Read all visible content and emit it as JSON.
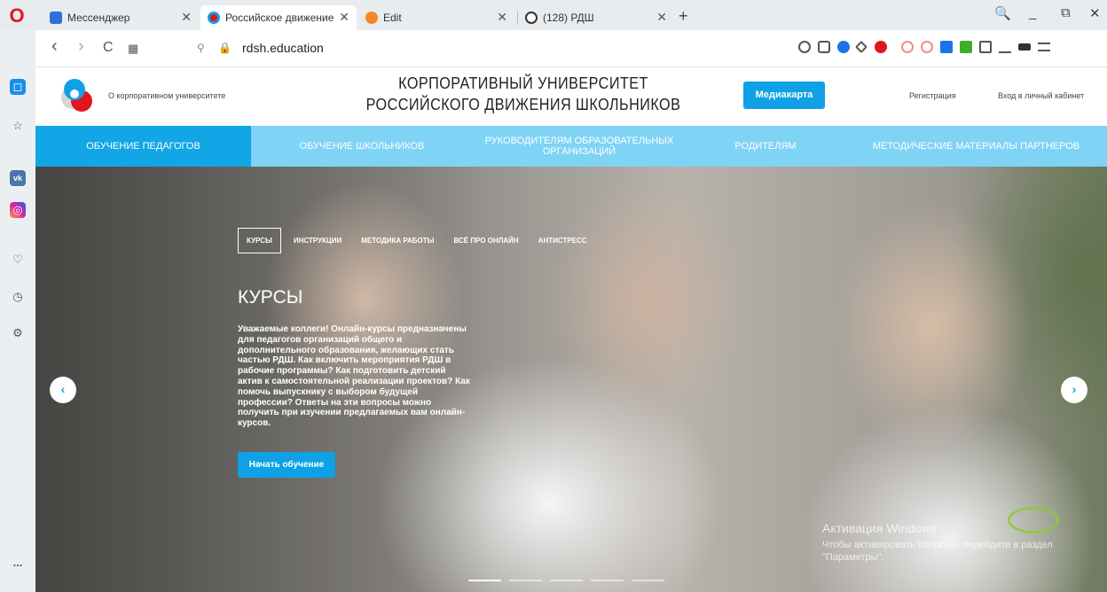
{
  "browser": {
    "tabs": [
      {
        "title": "Мессенджер",
        "active": false
      },
      {
        "title": "Российское движение шк",
        "active": true
      },
      {
        "title": "Edit",
        "active": false
      },
      {
        "title": "(128) РДШ",
        "active": false
      }
    ],
    "new_tab": "+",
    "close_glyph": "✕",
    "url": "rdsh.education",
    "controls": {
      "search": "🔍",
      "minimize": "_",
      "maximize": "⧉",
      "close": "✕"
    },
    "nav": {
      "back": "‹",
      "forward": "›",
      "reload": "C",
      "grid": "▦"
    }
  },
  "sidebar": {
    "icons": [
      "opera-home-icon",
      "bookmarks-star-icon",
      "vk-icon",
      "instagram-icon",
      "heart-icon",
      "history-clock-icon",
      "settings-gear-icon",
      "more-dots-icon"
    ],
    "more_label": "..."
  },
  "header": {
    "about_link": "О корпоративном университете",
    "title": "Корпоративный университет Российского движения школьников",
    "mediamap_button": "Медиакарта",
    "register_link": "Регистрация",
    "login_link": "Вход в личный кабинет"
  },
  "nav": {
    "items": [
      {
        "label": "Обучение педагогов",
        "active": true
      },
      {
        "label": "Обучение школьников",
        "active": false
      },
      {
        "label": "Руководителям образовательных организаций",
        "active": false
      },
      {
        "label": "Родителям",
        "active": false
      },
      {
        "label": "Методические материалы партнеров",
        "active": false
      }
    ]
  },
  "hero": {
    "tabs": [
      {
        "label": "Курсы",
        "active": true
      },
      {
        "label": "Инструкции",
        "active": false
      },
      {
        "label": "Методика работы",
        "active": false
      },
      {
        "label": "Всё про онлайн",
        "active": false
      },
      {
        "label": "Антистресс",
        "active": false
      }
    ],
    "heading": "Курсы",
    "text": "Уважаемые коллеги! Онлайн-курсы предназначены для педагогов организаций общего и дополнительного образования, желающих стать частью РДШ. Как включить мероприятия РДШ в рабочие программы? Как подготовить детский актив к самостоятельной реализации проектов? Как помочь выпускнику с выбором будущей профессии? Ответы на эти вопросы можно получить при изучении предлагаемых вам онлайн-курсов.",
    "cta": "Начать обучение",
    "prev": "‹",
    "next": "›",
    "slides_count": 5,
    "active_slide": 0
  },
  "watermark": {
    "line1": "Активация Windows",
    "line2": "Чтобы активировать Windows, перейдите в раздел \"Параметры\"."
  },
  "colors": {
    "accent": "#0fa1e6",
    "nav_bg": "#7fd3f5",
    "nav_active": "#12a6e6",
    "opera_red": "#e0161f"
  }
}
